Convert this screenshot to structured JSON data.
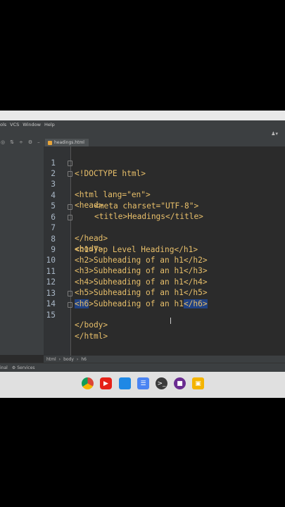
{
  "menubar": {
    "items": [
      "ols",
      "VCS",
      "Window",
      "Help"
    ]
  },
  "toolbar": {
    "user_icon": "user-icon"
  },
  "tab": {
    "label": "headings.html"
  },
  "editor": {
    "lines": [
      "1",
      "2",
      "3",
      "4",
      "5",
      "6",
      "7",
      "8",
      "9",
      "10",
      "11",
      "12",
      "13",
      "14",
      "15"
    ],
    "code": {
      "doctype": "<!DOCTYPE html>",
      "html_open": "<html lang=\"en\">",
      "head_open": "<head>",
      "meta": "<meta charset=\"UTF-8\">",
      "title": "<title>Headings</title>",
      "head_close": "</head>",
      "body_open": "<body>",
      "h1": "<h1>Top Level Heading</h1>",
      "h2": "<h2>Subheading of an h1</h2>",
      "h3": "<h3>Subheading of an h1</h3>",
      "h4": "<h4>Subheading of an h1</h4>",
      "h5": "<h5>Subheading of an h1</h5>",
      "h6_tag_open": "<h6",
      "h6_rest": ">Subheading of an h1",
      "h6_tag_close": "</h6>",
      "body_close": "</body>",
      "html_close": "</html>"
    }
  },
  "breadcrumbs": [
    "html",
    "body",
    "h6"
  ],
  "status": {
    "left": "inal",
    "services": "Services"
  },
  "shelf": [
    "chrome-icon",
    "youtube-icon",
    "files-icon",
    "docs-icon",
    "terminal-icon",
    "app-icon",
    "photos-icon"
  ]
}
